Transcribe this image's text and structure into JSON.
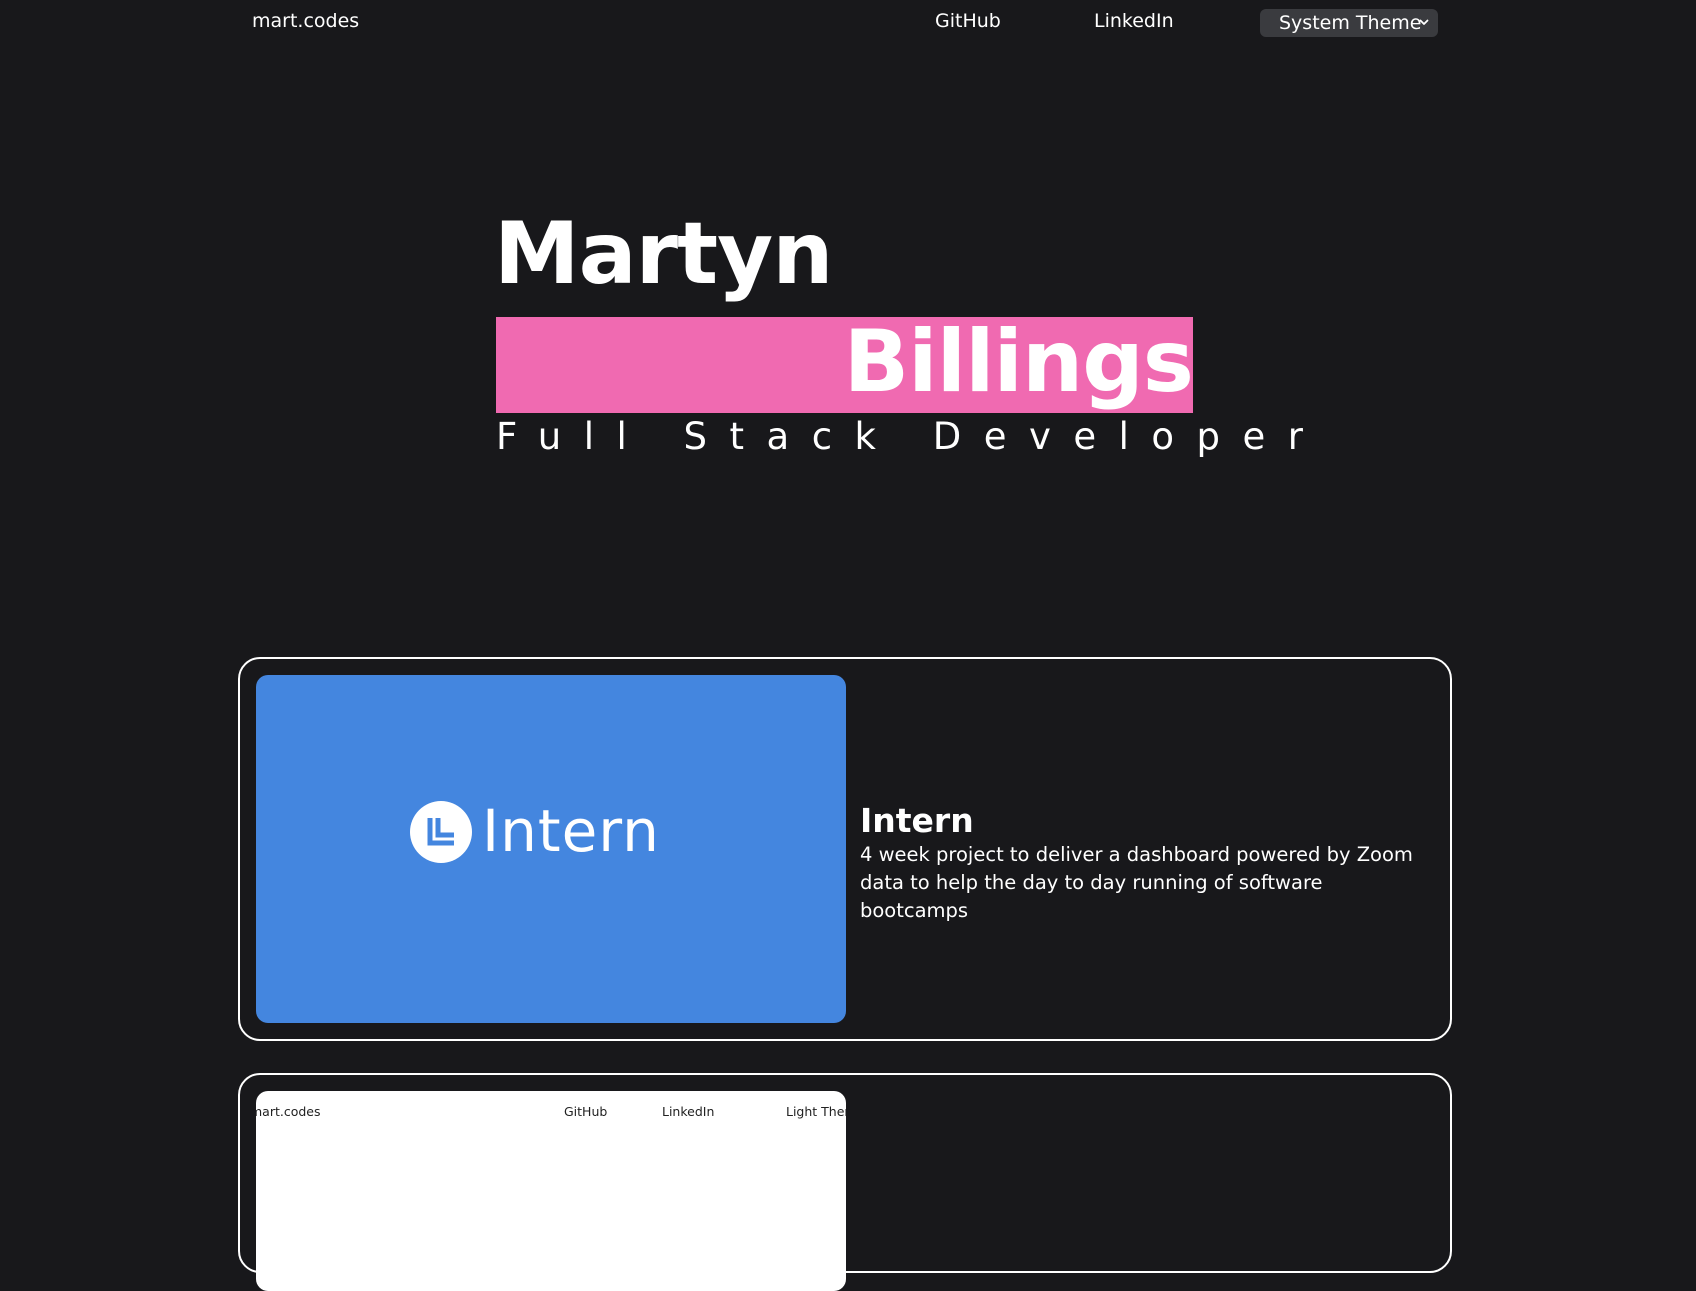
{
  "nav": {
    "brand": "mart.codes",
    "links": [
      "GitHub",
      "LinkedIn"
    ],
    "theme_select": {
      "selected": "System Theme"
    }
  },
  "hero": {
    "first_name": "Martyn",
    "last_name": "Billings",
    "role": "Full Stack Developer"
  },
  "projects": [
    {
      "title": "Intern",
      "description": "4 week project to deliver a dashboard powered by Zoom data to help the day to day running of software bootcamps",
      "thumbnail": {
        "logo_text": "Intern",
        "logo_icon": "intern-logo-icon",
        "background": "#4486df"
      }
    },
    {
      "thumbnail": {
        "nav_brand": "mart.codes",
        "nav_links": [
          "GitHub",
          "LinkedIn"
        ],
        "theme": "Light Theme"
      }
    }
  ],
  "colors": {
    "background": "#18181b",
    "accent": "#f06ab1",
    "text": "#ffffff"
  }
}
